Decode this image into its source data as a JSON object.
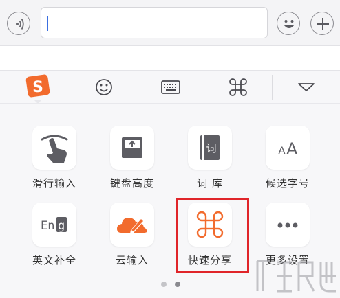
{
  "colors": {
    "accent_orange": "#f26b2d",
    "icon_gray": "#5d5d63",
    "highlight_red": "#e0252a",
    "dot_inactive": "#c4c4c8",
    "dot_active": "#8a8a90"
  },
  "chat_bar": {
    "voice_icon": "voice-wave-icon",
    "input_value": "",
    "emoji_icon": "smiley-icon",
    "plus_icon": "plus-icon"
  },
  "toolbar": {
    "items": [
      {
        "name": "sogou-logo-icon",
        "active": true
      },
      {
        "name": "emoji-icon"
      },
      {
        "name": "keyboard-icon"
      },
      {
        "name": "command-share-icon"
      },
      {
        "name": "collapse-triangle-icon"
      }
    ]
  },
  "grid": {
    "items": [
      {
        "label": "滑行输入",
        "icon": "swipe-hand-icon"
      },
      {
        "label": "键盘高度",
        "icon": "keyboard-height-icon"
      },
      {
        "label": "词 库",
        "icon": "dictionary-book-icon",
        "icon_text": "词"
      },
      {
        "label": "候选字号",
        "icon": "font-size-icon",
        "icon_text": "AA"
      },
      {
        "label": "英文补全",
        "icon": "english-complete-icon",
        "icon_text": "Eng"
      },
      {
        "label": "云输入",
        "icon": "cloud-input-icon"
      },
      {
        "label": "快速分享",
        "icon": "quick-share-icon",
        "highlighted": true
      },
      {
        "label": "更多设置",
        "icon": "more-dots-icon",
        "icon_text": "•••"
      }
    ]
  },
  "pagination": {
    "pages": 2,
    "current": 2
  }
}
